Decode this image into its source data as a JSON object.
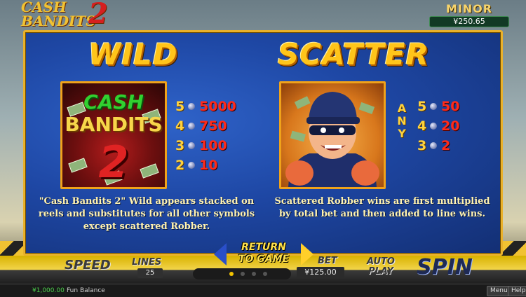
{
  "game": {
    "logo_line1": "CASH",
    "logo_line2": "BANDITS",
    "logo_number": "2"
  },
  "jackpot": {
    "label": "MINOR",
    "value": "¥250.65"
  },
  "paytable": {
    "wild": {
      "title": "WILD",
      "symbol_text_line1": "CASH",
      "symbol_text_line2": "BANDITS",
      "symbol_text_number": "2",
      "pays": [
        {
          "count": "5",
          "value": "5000"
        },
        {
          "count": "4",
          "value": "750"
        },
        {
          "count": "3",
          "value": "100"
        },
        {
          "count": "2",
          "value": "10"
        }
      ],
      "description": "\"Cash Bandits 2\" Wild appears stacked on reels and substitutes for all other symbols except scattered Robber."
    },
    "scatter": {
      "title": "SCATTER",
      "any_label": [
        "A",
        "N",
        "Y"
      ],
      "pays": [
        {
          "count": "5",
          "value": "50"
        },
        {
          "count": "4",
          "value": "20"
        },
        {
          "count": "3",
          "value": "2"
        }
      ],
      "description": "Scattered Robber wins are first multiplied by total bet and then added to line wins."
    },
    "return_label_line1": "RETURN",
    "return_label_line2": "TO GAME",
    "page_indicator": {
      "total": 4,
      "active": 1
    }
  },
  "controls": {
    "speed_label": "SPEED",
    "lines_label": "LINES",
    "lines_value": "25",
    "bet_label": "BET",
    "bet_value": "¥125.00",
    "autoplay_label_line1": "AUTO",
    "autoplay_label_line2": "PLAY",
    "spin_label": "SPIN"
  },
  "status": {
    "balance_value": "¥1,000.00",
    "balance_label": "Fun Balance",
    "menu_label": "Menu",
    "help_label": "Help"
  },
  "colors": {
    "panel_border": "#e9b12b",
    "panel_bg": "#1e47a4",
    "title_gold": "#ffc51a",
    "pay_red": "#ff2a1a",
    "pay_count_yellow": "#ffd23c"
  }
}
